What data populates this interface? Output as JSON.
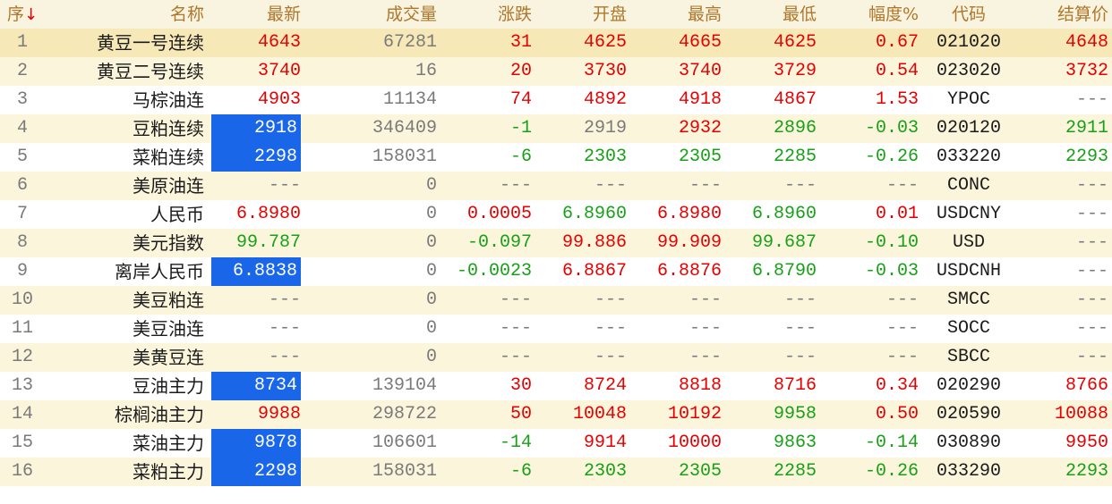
{
  "colors": {
    "header_text": "#b0762b",
    "header_bg": "#f8f4df",
    "up": "#e60000",
    "down": "#18a018",
    "neutral": "#7a7a7a",
    "name": "#1b1b1b",
    "highlight_bg": "#1a66e8",
    "selected_row_bg": "#f6e8b7"
  },
  "header": {
    "seq": "序",
    "sort_icon": "↓",
    "name": "名称",
    "last": "最新",
    "volume": "成交量",
    "change": "涨跌",
    "open": "开盘",
    "high": "最高",
    "low": "最低",
    "pct": "幅度%",
    "code": "代码",
    "settle": "结算价"
  },
  "rows": [
    {
      "seq": "1",
      "name": "黄豆一号连续",
      "last": "4643",
      "last_c": "up",
      "vol": "67281",
      "chg": "31",
      "chg_c": "up",
      "open": "4625",
      "open_c": "up",
      "high": "4665",
      "high_c": "up",
      "low": "4625",
      "low_c": "up",
      "pct": "0.67",
      "pct_c": "up",
      "code": "021020",
      "settle": "4648",
      "settle_c": "up",
      "hl": false
    },
    {
      "seq": "2",
      "name": "黄豆二号连续",
      "last": "3740",
      "last_c": "up",
      "vol": "16",
      "chg": "20",
      "chg_c": "up",
      "open": "3730",
      "open_c": "up",
      "high": "3740",
      "high_c": "up",
      "low": "3729",
      "low_c": "up",
      "pct": "0.54",
      "pct_c": "up",
      "code": "023020",
      "settle": "3732",
      "settle_c": "up",
      "hl": false
    },
    {
      "seq": "3",
      "name": "马棕油连",
      "last": "4903",
      "last_c": "up",
      "vol": "11134",
      "chg": "74",
      "chg_c": "up",
      "open": "4892",
      "open_c": "up",
      "high": "4918",
      "high_c": "up",
      "low": "4867",
      "low_c": "up",
      "pct": "1.53",
      "pct_c": "up",
      "code": "YPOC",
      "settle": "---",
      "settle_c": "neutral",
      "hl": false
    },
    {
      "seq": "4",
      "name": "豆粕连续",
      "last": "2918",
      "last_c": "down",
      "vol": "346409",
      "chg": "-1",
      "chg_c": "down",
      "open": "2919",
      "open_c": "neutral",
      "high": "2932",
      "high_c": "up",
      "low": "2896",
      "low_c": "down",
      "pct": "-0.03",
      "pct_c": "down",
      "code": "020120",
      "settle": "2911",
      "settle_c": "down",
      "hl": true
    },
    {
      "seq": "5",
      "name": "菜粕连续",
      "last": "2298",
      "last_c": "down",
      "vol": "158031",
      "chg": "-6",
      "chg_c": "down",
      "open": "2303",
      "open_c": "down",
      "high": "2305",
      "high_c": "down",
      "low": "2285",
      "low_c": "down",
      "pct": "-0.26",
      "pct_c": "down",
      "code": "033220",
      "settle": "2293",
      "settle_c": "down",
      "hl": true
    },
    {
      "seq": "6",
      "name": "美原油连",
      "last": "---",
      "last_c": "neutral",
      "vol": "0",
      "chg": "---",
      "chg_c": "neutral",
      "open": "---",
      "open_c": "neutral",
      "high": "---",
      "high_c": "neutral",
      "low": "---",
      "low_c": "neutral",
      "pct": "---",
      "pct_c": "neutral",
      "code": "CONC",
      "settle": "---",
      "settle_c": "neutral",
      "hl": false
    },
    {
      "seq": "7",
      "name": "人民币",
      "last": "6.8980",
      "last_c": "up",
      "vol": "0",
      "chg": "0.0005",
      "chg_c": "up",
      "open": "6.8960",
      "open_c": "down",
      "high": "6.8980",
      "high_c": "up",
      "low": "6.8960",
      "low_c": "down",
      "pct": "0.01",
      "pct_c": "up",
      "code": "USDCNY",
      "settle": "---",
      "settle_c": "neutral",
      "hl": false
    },
    {
      "seq": "8",
      "name": "美元指数",
      "last": "99.787",
      "last_c": "down",
      "vol": "0",
      "chg": "-0.097",
      "chg_c": "down",
      "open": "99.886",
      "open_c": "up",
      "high": "99.909",
      "high_c": "up",
      "low": "99.687",
      "low_c": "down",
      "pct": "-0.10",
      "pct_c": "down",
      "code": "USD",
      "settle": "---",
      "settle_c": "neutral",
      "hl": false
    },
    {
      "seq": "9",
      "name": "离岸人民币",
      "last": "6.8838",
      "last_c": "down",
      "vol": "0",
      "chg": "-0.0023",
      "chg_c": "down",
      "open": "6.8867",
      "open_c": "up",
      "high": "6.8876",
      "high_c": "up",
      "low": "6.8790",
      "low_c": "down",
      "pct": "-0.03",
      "pct_c": "down",
      "code": "USDCNH",
      "settle": "---",
      "settle_c": "neutral",
      "hl": true
    },
    {
      "seq": "10",
      "name": "美豆粕连",
      "last": "---",
      "last_c": "neutral",
      "vol": "0",
      "chg": "---",
      "chg_c": "neutral",
      "open": "---",
      "open_c": "neutral",
      "high": "---",
      "high_c": "neutral",
      "low": "---",
      "low_c": "neutral",
      "pct": "---",
      "pct_c": "neutral",
      "code": "SMCC",
      "settle": "---",
      "settle_c": "neutral",
      "hl": false
    },
    {
      "seq": "11",
      "name": "美豆油连",
      "last": "---",
      "last_c": "neutral",
      "vol": "0",
      "chg": "---",
      "chg_c": "neutral",
      "open": "---",
      "open_c": "neutral",
      "high": "---",
      "high_c": "neutral",
      "low": "---",
      "low_c": "neutral",
      "pct": "---",
      "pct_c": "neutral",
      "code": "SOCC",
      "settle": "---",
      "settle_c": "neutral",
      "hl": false
    },
    {
      "seq": "12",
      "name": "美黄豆连",
      "last": "---",
      "last_c": "neutral",
      "vol": "0",
      "chg": "---",
      "chg_c": "neutral",
      "open": "---",
      "open_c": "neutral",
      "high": "---",
      "high_c": "neutral",
      "low": "---",
      "low_c": "neutral",
      "pct": "---",
      "pct_c": "neutral",
      "code": "SBCC",
      "settle": "---",
      "settle_c": "neutral",
      "hl": false
    },
    {
      "seq": "13",
      "name": "豆油主力",
      "last": "8734",
      "last_c": "up",
      "vol": "139104",
      "chg": "30",
      "chg_c": "up",
      "open": "8724",
      "open_c": "up",
      "high": "8818",
      "high_c": "up",
      "low": "8716",
      "low_c": "up",
      "pct": "0.34",
      "pct_c": "up",
      "code": "020290",
      "settle": "8766",
      "settle_c": "up",
      "hl": true
    },
    {
      "seq": "14",
      "name": "棕榈油主力",
      "last": "9988",
      "last_c": "up",
      "vol": "298722",
      "chg": "50",
      "chg_c": "up",
      "open": "10048",
      "open_c": "up",
      "high": "10192",
      "high_c": "up",
      "low": "9958",
      "low_c": "down",
      "pct": "0.50",
      "pct_c": "up",
      "code": "020590",
      "settle": "10088",
      "settle_c": "up",
      "hl": false
    },
    {
      "seq": "15",
      "name": "菜油主力",
      "last": "9878",
      "last_c": "down",
      "vol": "106601",
      "chg": "-14",
      "chg_c": "down",
      "open": "9914",
      "open_c": "up",
      "high": "10000",
      "high_c": "up",
      "low": "9863",
      "low_c": "down",
      "pct": "-0.14",
      "pct_c": "down",
      "code": "030890",
      "settle": "9950",
      "settle_c": "up",
      "hl": true
    },
    {
      "seq": "16",
      "name": "菜粕主力",
      "last": "2298",
      "last_c": "down",
      "vol": "158031",
      "chg": "-6",
      "chg_c": "down",
      "open": "2303",
      "open_c": "down",
      "high": "2305",
      "high_c": "down",
      "low": "2285",
      "low_c": "down",
      "pct": "-0.26",
      "pct_c": "down",
      "code": "033290",
      "settle": "2293",
      "settle_c": "down",
      "hl": true
    }
  ]
}
